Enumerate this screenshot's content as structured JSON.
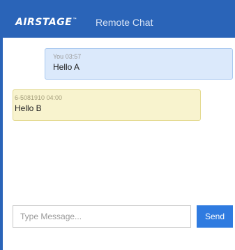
{
  "header": {
    "logo": "AIRSTAGE",
    "logo_tm": "™",
    "title": "Remote Chat"
  },
  "messages": [
    {
      "sender": "You",
      "time": "03:57",
      "meta": "You 03:57",
      "text": "Hello A"
    },
    {
      "sender": "6-5081910",
      "time": "04:00",
      "meta": "6-5081910 04:00",
      "text": "Hello B"
    }
  ],
  "composer": {
    "placeholder": "Type Message...",
    "value": "",
    "send_label": "Send"
  },
  "colors": {
    "header_bg": "#2a64b8",
    "mine_bubble": "#dbe9fb",
    "theirs_bubble": "#f8f3ce",
    "send_button": "#2f7be0"
  }
}
